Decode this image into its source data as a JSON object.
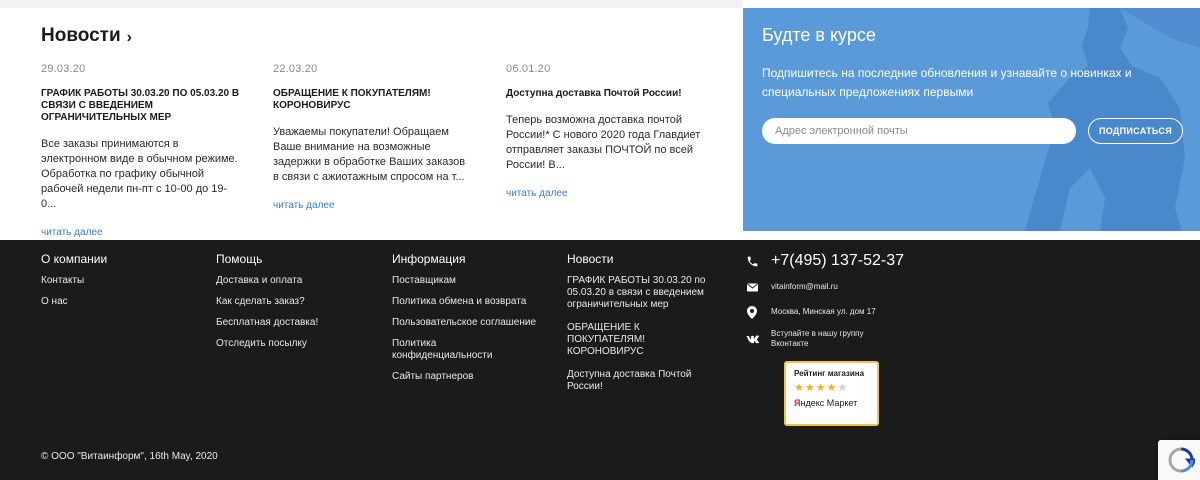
{
  "news": {
    "title": "Новости",
    "chevron": "›",
    "items": [
      {
        "date": "29.03.20",
        "headline": "ГРАФИК РАБОТЫ 30.03.20 по 05.03.20 в связи с введением ограничительных мер",
        "text": "Все заказы принимаются в электронном виде в обычном режиме. Обработка по графику обычной рабочей недели пн-пт с 10-00 до 19-0...",
        "read_more": "читать далее"
      },
      {
        "date": "22.03.20",
        "headline": "ОБРАЩЕНИЕ К ПОКУПАТЕЛЯМ! КОРОНОВИРУС",
        "text": "Уважаемы покупатели! Обращаем Ваше внимание на возможные задержки в обработке Ваших заказов в связи с ажиотажным спросом на т...",
        "read_more": "читать далее"
      },
      {
        "date": "06.01.20",
        "headline": "Доступна доставка Почтой России!",
        "text": "Теперь возможна доставка почтой России!* С нового 2020 года Главдиет отправляет заказы ПОЧТОЙ по всей России! В...",
        "read_more": "читать далее"
      }
    ]
  },
  "subscribe": {
    "title": "Будте в курсе",
    "description": "Подпишитесь на последние обновления и узнавайте о новинках и специальных предложениях первыми",
    "email_placeholder": "Адрес электронной почты",
    "button_label": "ПОДПИСАТЬСЯ",
    "bg_color": "#5b9ad9"
  },
  "footer": {
    "columns": [
      {
        "title": "О компании",
        "links": [
          "Контакты",
          "О нас"
        ]
      },
      {
        "title": "Помощь",
        "links": [
          "Доставка и оплата",
          "Как сделать заказ?",
          "Бесплатная доставка!",
          "Отследить посылку"
        ]
      },
      {
        "title": "Информация",
        "links": [
          "Поставщикам",
          "Политика обмена и возврата",
          "Пользовательское соглашение",
          "Политика конфиденциальности",
          "Сайты партнеров"
        ]
      },
      {
        "title": "Новости",
        "links": [
          "ГРАФИК РАБОТЫ 30.03.20 по 05.03.20 в связи с введением ограничительных мер",
          "ОБРАЩЕНИЕ К ПОКУПАТЕЛЯМ! КОРОНОВИРУС",
          "Доступна доставка Почтой России!"
        ]
      }
    ],
    "contacts": {
      "phone": "+7(495) 137-52-37",
      "email": "vitainform@mail.ru",
      "address": "Москва, Минская ул. дом 17",
      "vk": "Вступайте в нашу группу Вконтакте"
    },
    "rating": {
      "title": "Рейтинг магазина",
      "stars": 4,
      "max_stars": 5,
      "brand_y": "Я",
      "brand_rest": "ндекс Маркет"
    },
    "copyright": "© ООО \"Витаинформ\", 16th May, 2020",
    "bg_color": "#1b1b1b"
  },
  "icons": {
    "phone": "phone-icon",
    "email": "envelope-icon",
    "address": "map-pin-icon",
    "vk": "vk-icon",
    "captcha": "recaptcha-icon"
  }
}
